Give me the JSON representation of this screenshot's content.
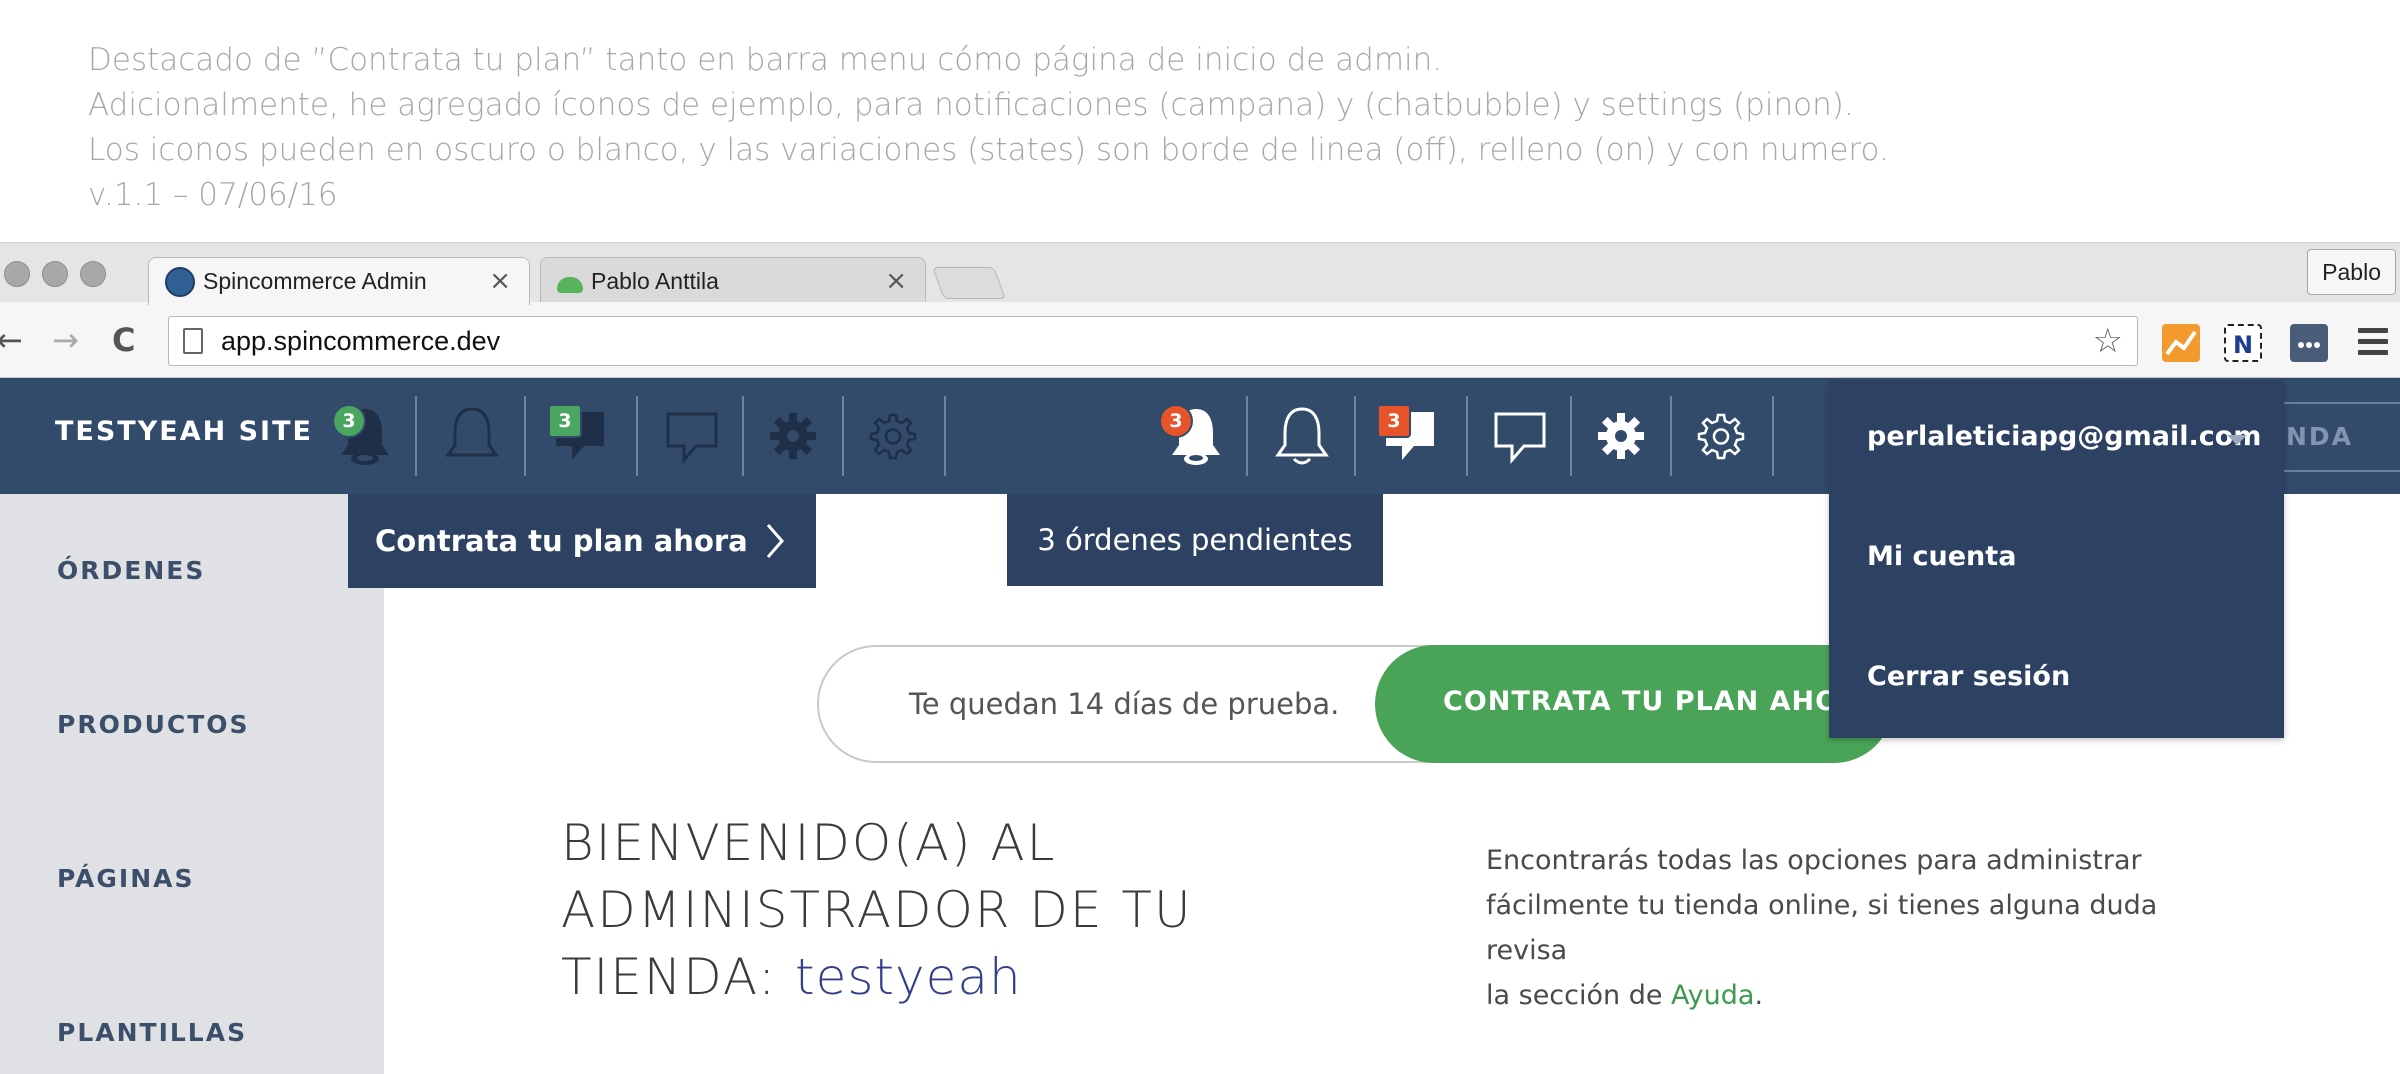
{
  "notes": [
    "Destacado de ”Contrata tu plan” tanto en barra menu cómo página de inicio de admin.",
    "Adicionalmente, he agregado íconos de ejemplo, para notificaciones (campana) y (chatbubble) y settings (pinon).",
    "Los iconos pueden en oscuro o blanco, y las variaciones (states) son borde de linea (off), relleno (on) y con numero.",
    "v.1.1 – 07/06/16"
  ],
  "browser": {
    "tabs": [
      {
        "title": "Spincommerce Admin",
        "close": "×"
      },
      {
        "title": "Pablo Anttila",
        "close": "×"
      }
    ],
    "profile": "Pablo",
    "url": "app.spincommerce.dev",
    "nav": {
      "back": "←",
      "forward": "→",
      "reload": "C"
    },
    "star": "☆"
  },
  "appbar": {
    "site_name": "TESTYEAH SITE",
    "badge_count": "3",
    "ghost_button": "NDA"
  },
  "tooltips": {
    "plan": "Contrata tu plan ahora",
    "orders": "3 órdenes pendientes"
  },
  "sidebar": {
    "items": [
      {
        "label": "ÓRDENES"
      },
      {
        "label": "PRODUCTOS"
      },
      {
        "label": "PÁGINAS"
      },
      {
        "label": "PLANTILLAS"
      }
    ]
  },
  "trial": {
    "text": "Te quedan 14 días de prueba.",
    "cta": "CONTRATA TU PLAN AHORA"
  },
  "welcome": {
    "line1": "BIENVENIDO(A) AL",
    "line2": "ADMINISTRADOR DE TU",
    "line3_prefix": "TIENDA: ",
    "store": "testyeah",
    "desc_line1": "Encontrarás todas las opciones para administrar",
    "desc_line2": "fácilmente tu tienda online, si tienes alguna duda revisa",
    "desc_line3_prefix": "la sección de ",
    "desc_link": "Ayuda",
    "desc_suffix": "."
  },
  "account": {
    "email": "perlaleticiapg@gmail.com",
    "menu": [
      {
        "label": "Mi cuenta"
      },
      {
        "label": "Cerrar sesión"
      }
    ]
  },
  "colors": {
    "appbar": "#324b6b",
    "tooltip": "#2d4262",
    "accent_green": "#4aa458",
    "badge_green": "#4aa560",
    "badge_orange": "#e8542a",
    "sidebar": "#e0e1e5"
  }
}
